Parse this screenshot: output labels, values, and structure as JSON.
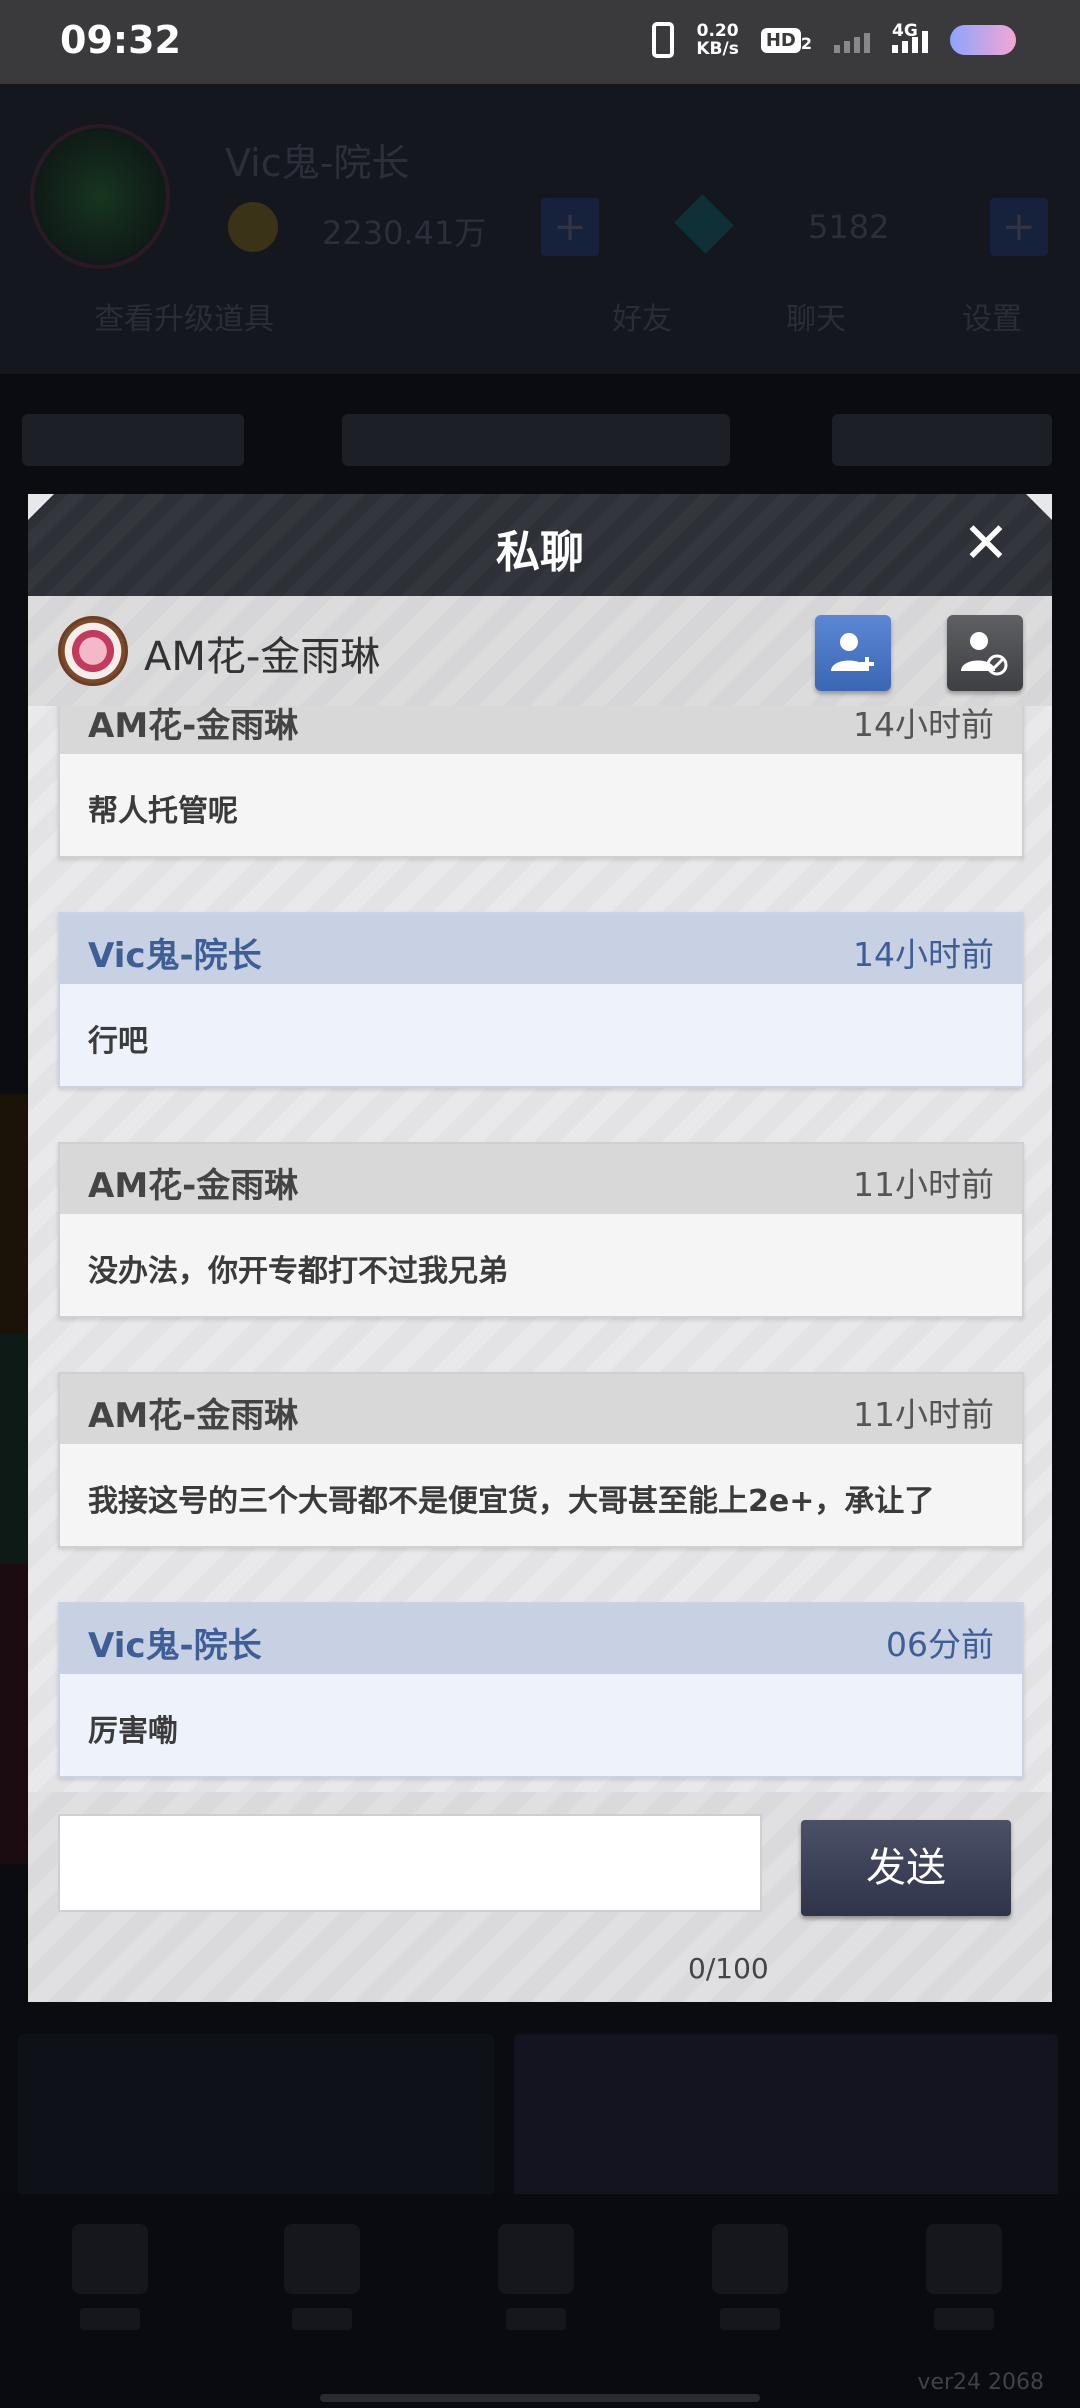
{
  "status_bar": {
    "time": "09:32",
    "net_speed_value": "0.20",
    "net_speed_unit": "KB/s",
    "hd_label": "HD",
    "hd_sub": "2",
    "network_type": "4G"
  },
  "background": {
    "player_name": "Vic鬼-院长",
    "coins": "2230.41万",
    "gems": "5182",
    "row_texts": [
      "查看升级道具",
      "好友",
      "聊天",
      "设置"
    ],
    "version": "ver24  2068"
  },
  "dialog": {
    "title": "私聊",
    "close_icon": "close-icon",
    "peer": {
      "name": "AM花-金雨琳",
      "add_friend_icon": "add-friend-icon",
      "block_icon": "block-user-icon"
    },
    "messages": [
      {
        "sender": "AM花-金雨琳",
        "time": "14小时前",
        "text": "帮人托管呢",
        "self": false
      },
      {
        "sender": "Vic鬼-院长",
        "time": "14小时前",
        "text": "行吧",
        "self": true
      },
      {
        "sender": "AM花-金雨琳",
        "time": "11小时前",
        "text": "没办法，你开专都打不过我兄弟",
        "self": false
      },
      {
        "sender": "AM花-金雨琳",
        "time": "11小时前",
        "text": "我接这号的三个大哥都不是便宜货，大哥甚至能上2e+，承让了",
        "self": false
      },
      {
        "sender": "Vic鬼-院长",
        "time": "06分前",
        "text": "厉害嘞",
        "self": true
      }
    ],
    "input": {
      "value": "",
      "placeholder": "",
      "send_label": "发送",
      "char_count": "0/100"
    }
  },
  "colors": {
    "self_header": "#c7d1e3",
    "self_name": "#3f5e96",
    "other_header": "#d8d8d9",
    "send_button": "#3a3f55"
  }
}
